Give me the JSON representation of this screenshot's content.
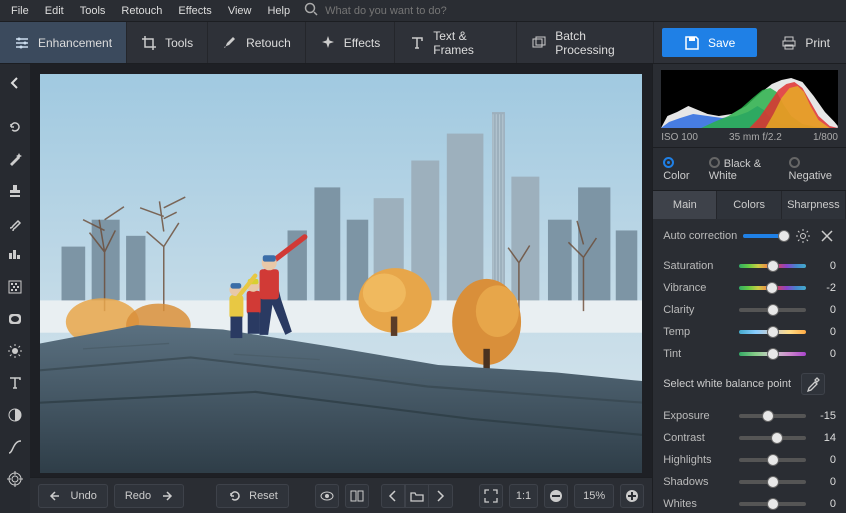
{
  "menu": {
    "items": [
      "File",
      "Edit",
      "Tools",
      "Retouch",
      "Effects",
      "View",
      "Help"
    ],
    "search_placeholder": "What do you want to do?"
  },
  "toolbar": {
    "enhancement": "Enhancement",
    "tools": "Tools",
    "retouch": "Retouch",
    "effects": "Effects",
    "text_frames": "Text & Frames",
    "batch": "Batch Processing",
    "save": "Save",
    "print": "Print"
  },
  "left_tools": [
    "back-icon",
    "rotate-icon",
    "magic-wand-icon",
    "stamp-icon",
    "brush-icon",
    "levels-icon",
    "pattern-icon",
    "vignette-icon",
    "brightness-icon",
    "text-icon",
    "contrast-icon",
    "curves-icon",
    "target-icon"
  ],
  "bottom": {
    "undo": "Undo",
    "redo": "Redo",
    "reset": "Reset",
    "zoom_ratio": "1:1",
    "zoom_pct": "15%"
  },
  "histogram": {
    "iso": "ISO 100",
    "lens": "35 mm f/2.2",
    "shutter": "1/800"
  },
  "modes": {
    "color": "Color",
    "bw": "Black & White",
    "negative": "Negative",
    "selected": "color"
  },
  "tabs": {
    "main": "Main",
    "colors": "Colors",
    "sharpness": "Sharpness",
    "active": "main"
  },
  "adjust": {
    "auto_label": "Auto correction",
    "auto_value": 90,
    "wb_label": "Select white balance point",
    "items": [
      {
        "label": "Saturation",
        "value": 0,
        "track": "rainbow"
      },
      {
        "label": "Vibrance",
        "value": -2,
        "track": "rainbow"
      },
      {
        "label": "Clarity",
        "value": 0,
        "track": "plain"
      },
      {
        "label": "Temp",
        "value": 0,
        "track": "temp"
      },
      {
        "label": "Tint",
        "value": 0,
        "track": "tint"
      }
    ],
    "items2": [
      {
        "label": "Exposure",
        "value": -15
      },
      {
        "label": "Contrast",
        "value": 14
      },
      {
        "label": "Highlights",
        "value": 0
      },
      {
        "label": "Shadows",
        "value": 0
      },
      {
        "label": "Whites",
        "value": 0
      }
    ]
  }
}
